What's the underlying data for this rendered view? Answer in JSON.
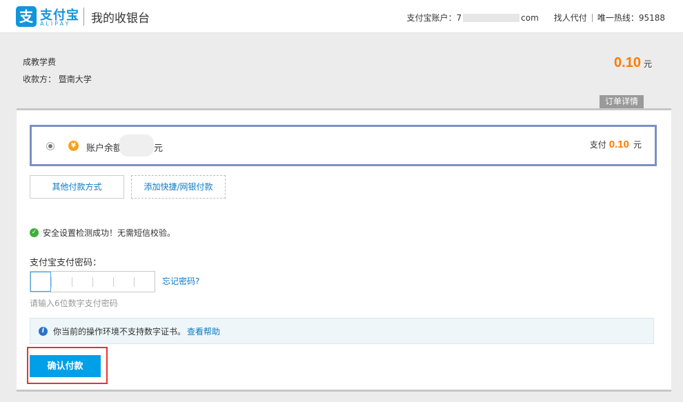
{
  "header": {
    "logo_glyph": "支",
    "brand_cn": "支付宝",
    "brand_en": "ALIPAY",
    "title": "我的收银台",
    "account_label": "支付宝账户：",
    "account_prefix": "7",
    "account_suffix": "com",
    "proxy_pay": "找人代付",
    "hotline": "唯一热线：95188"
  },
  "order": {
    "name": "成教学费",
    "payee_label": "收款方：",
    "payee": "暨南大学",
    "amount": "0.10",
    "unit": "元",
    "detail_tab": "订单详情"
  },
  "balance": {
    "icon": "yen-icon",
    "label": "账户余额",
    "unit": "元",
    "pay_label": "支付",
    "pay_amount": "0.10",
    "pay_unit": "元"
  },
  "methods": {
    "other": "其他付款方式",
    "add": "添加快捷/网银付款"
  },
  "security": {
    "message": "安全设置检测成功！无需短信校验。"
  },
  "password": {
    "label": "支付宝支付密码：",
    "forgot": "忘记密码?",
    "hint": "请输入6位数字支付密码"
  },
  "notice": {
    "text": "你当前的操作环境不支持数字证书。",
    "link": "查看帮助"
  },
  "confirm": {
    "label": "确认付款"
  },
  "colors": {
    "brand": "#1296db",
    "amount": "#ff7a00",
    "link": "#0a7ac4",
    "button": "#00a0e9",
    "highlight": "#e8322e"
  }
}
